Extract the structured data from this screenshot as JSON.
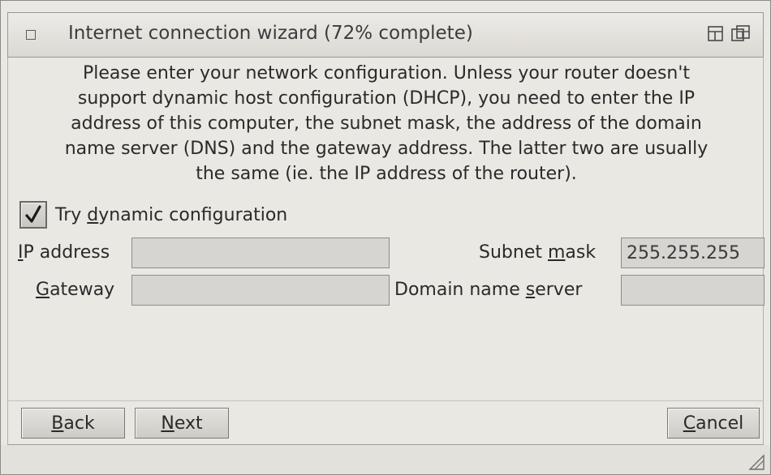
{
  "window": {
    "title": "Internet connection wizard (72% complete)",
    "progress_percent": 72
  },
  "intro_text": "Please enter your network configuration. Unless your router doesn't\nsupport dynamic host configuration (DHCP), you need to enter the IP\naddress of this computer, the subnet mask, the address of the domain\nname server (DNS) and the gateway address. The latter two are usually\nthe same (ie. the IP address of the router).",
  "dynamic_config": {
    "label_before": "Try ",
    "label_mnemonic": "d",
    "label_after": "ynamic configuration",
    "checked": true
  },
  "fields": {
    "ip_address": {
      "label_mnemonic": "I",
      "label_rest": "P address",
      "value": ""
    },
    "subnet_mask": {
      "label_before": "Subnet ",
      "label_mnemonic": "m",
      "label_after": "ask",
      "value": "255.255.255"
    },
    "gateway": {
      "label_mnemonic": "G",
      "label_rest": "ateway",
      "value": ""
    },
    "dns": {
      "label_before": "Domain name ",
      "label_mnemonic": "s",
      "label_after": "erver",
      "value": ""
    }
  },
  "buttons": {
    "back": {
      "mnemonic": "B",
      "rest": "ack"
    },
    "next": {
      "mnemonic": "N",
      "rest": "ext"
    },
    "cancel": {
      "mnemonic": "C",
      "rest": "ancel"
    }
  },
  "icons": {
    "window_menu": "window-menu-icon",
    "maximize": "maximize-icon",
    "restore": "restore-icon",
    "check": "checkmark-icon",
    "resize": "resize-grip-icon"
  }
}
